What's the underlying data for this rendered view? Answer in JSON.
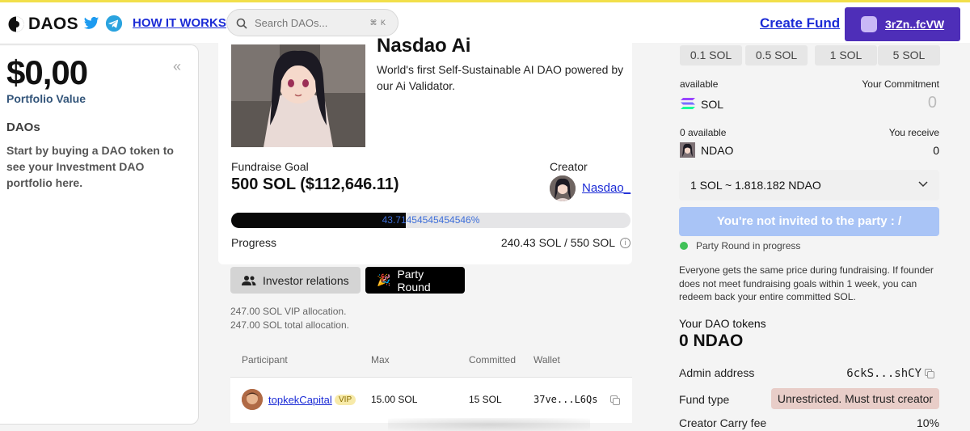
{
  "header": {
    "logo_text": "DAOS",
    "how_it_works": "HOW IT WORKS",
    "search_placeholder": "Search DAOs...",
    "search_shortcut": "⌘ K",
    "create_fund": "Create Fund",
    "wallet_address": "3rZn..fcVW"
  },
  "sidebar": {
    "portfolio_value": "$0,00",
    "portfolio_label": "Portfolio Value",
    "daos_heading": "DAOs",
    "empty_text": "Start by buying a DAO token to see your Investment DAO portfolio here.",
    "collapse_icon": "«"
  },
  "dao": {
    "title": "Nasdao Ai",
    "tagline": "World's first Self-Sustainable AI DAO powered by our Ai Validator.",
    "goal_label": "Fundraise Goal",
    "goal_value": "500 SOL ($112,646.11)",
    "creator_label": "Creator",
    "creator_name": "Nasdao_",
    "progress_percent_text": "43.71454545454546%",
    "progress_fraction": 0.4371,
    "progress_label": "Progress",
    "progress_value": "240.43 SOL / 550 SOL",
    "info_icon": "i"
  },
  "tabs": {
    "investor": "Investor relations",
    "party": "Party Round",
    "party_emoji": "🎉"
  },
  "allocation": {
    "vip": "247.00 SOL VIP allocation.",
    "total": "247.00 SOL total allocation."
  },
  "table": {
    "headers": [
      "Participant",
      "Max",
      "Committed",
      "Wallet"
    ],
    "rows": [
      {
        "participant": "topkekCapital",
        "badge": "VIP",
        "max": "15.00 SOL",
        "committed": "15 SOL",
        "wallet": "37ve...L6Qs"
      }
    ]
  },
  "buy": {
    "amounts": [
      "0.1 SOL",
      "0.5 SOL",
      "1 SOL",
      "5 SOL"
    ],
    "available_1": "available",
    "commitment_label": "Your Commitment",
    "sol_label": "SOL",
    "commitment_value": "0",
    "available_2": "0 available",
    "receive_label": "You receive",
    "token_label": "NDAO",
    "receive_value": "0",
    "rate": "1 SOL ~ 1.818.182 NDAO",
    "cta": "You're not invited to the party : /",
    "status": "Party Round in progress",
    "description": "Everyone gets the same price during fundraising. If founder does not meet fundraising goals within 1 week, you can redeem back your entire committed SOL."
  },
  "details": {
    "tokens_label": "Your DAO tokens",
    "tokens_value": "0 NDAO",
    "admin_label": "Admin address",
    "admin_value": "6ckS...shCY",
    "fund_type_label": "Fund type",
    "fund_type_value": "Unrestricted. Must trust creator",
    "carry_label": "Creator Carry fee",
    "carry_value": "10%"
  },
  "colors": {
    "accent": "#1b2bd6",
    "wallet_bg": "#4e2eb8",
    "cta_bg": "#a9c4f6",
    "progress_fill": "#080808",
    "status_green": "#3fc157",
    "fund_badge_bg": "#e8cdc8"
  }
}
